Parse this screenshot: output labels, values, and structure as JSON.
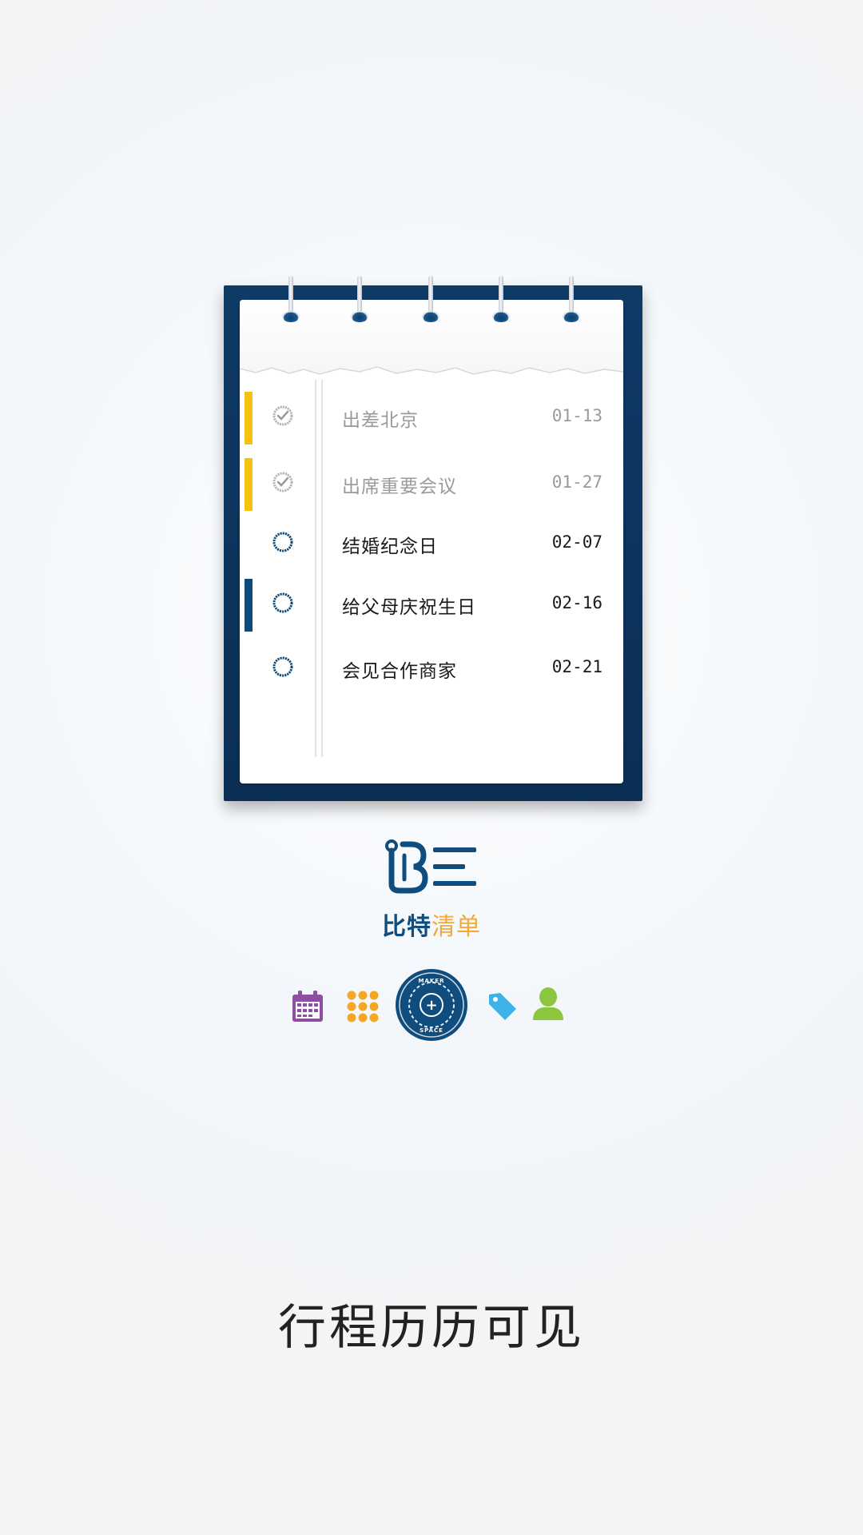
{
  "colors": {
    "notebook_blue": "#0b2f55",
    "accent_yellow": "#f5c211",
    "accent_blue": "#0b4a7a",
    "brand_blue": "#0e4d7d",
    "brand_orange": "#f2a93b",
    "calendar_purple": "#8e4fa3",
    "grid_orange": "#f5a623",
    "tag_blue": "#3db2e6",
    "user_green": "#8cc63f"
  },
  "tasks": [
    {
      "title": "出差北京",
      "date": "01-13",
      "done": true,
      "flag": "yellow"
    },
    {
      "title": "出席重要会议",
      "date": "01-27",
      "done": true,
      "flag": "yellow"
    },
    {
      "title": "结婚纪念日",
      "date": "02-07",
      "done": false,
      "flag": "none"
    },
    {
      "title": "给父母庆祝生日",
      "date": "02-16",
      "done": false,
      "flag": "blue"
    },
    {
      "title": "会见合作商家",
      "date": "02-21",
      "done": false,
      "flag": "none"
    }
  ],
  "brand": {
    "part1": "比特",
    "part2": "清单"
  },
  "center_badge": {
    "top_text": "MAKER",
    "bottom_text": "SPACE",
    "symbol": "+"
  },
  "icons": [
    "calendar-icon",
    "grid-icon",
    "maker-space-badge-icon",
    "tag-icon",
    "user-icon"
  ],
  "tagline": "行程历历可见"
}
